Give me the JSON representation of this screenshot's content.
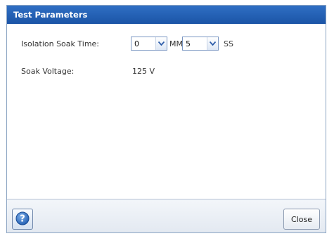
{
  "dialog": {
    "title": "Test Parameters"
  },
  "fields": {
    "soak_time_label": "Isolation Soak Time:",
    "minutes_value": "0",
    "minutes_unit": "MM",
    "seconds_value": "5",
    "seconds_unit": "SS",
    "soak_voltage_label": "Soak Voltage:",
    "soak_voltage_value": "125 V"
  },
  "footer": {
    "close_label": "Close",
    "help_icon": "help-icon"
  },
  "colors": {
    "titlebar": "#1f5cb0",
    "titlebar_text": "#ffffff",
    "help_icon": "#2d6cc0"
  }
}
